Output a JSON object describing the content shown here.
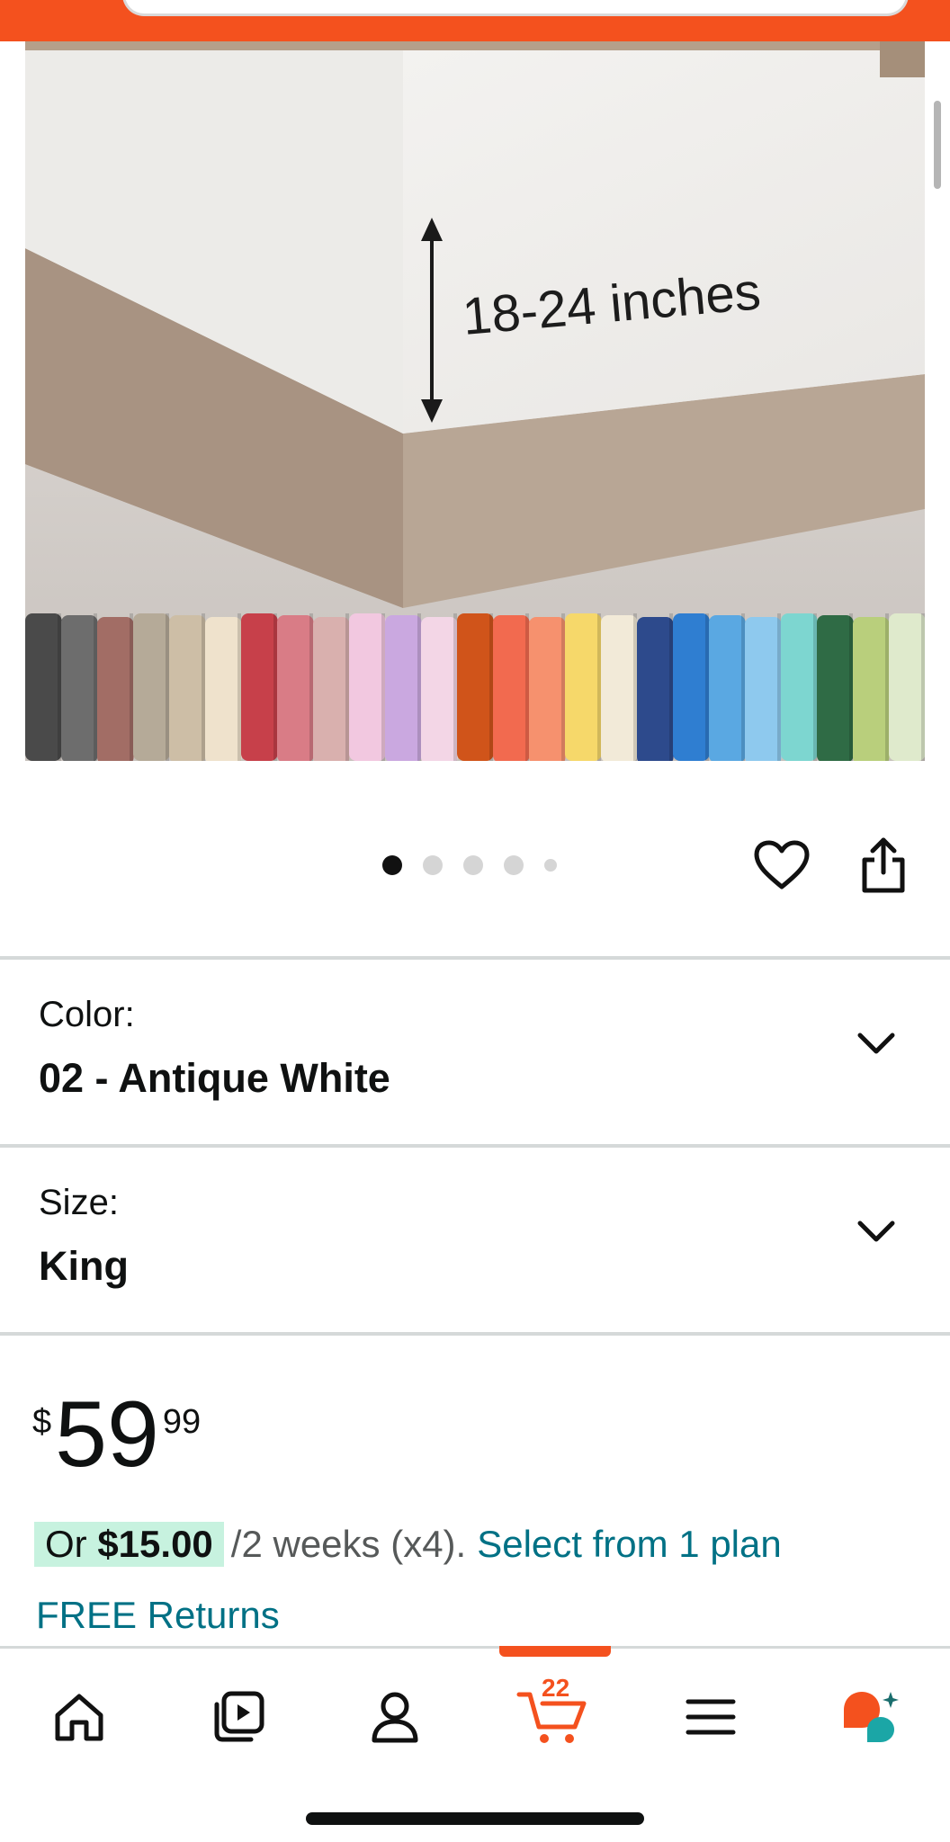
{
  "product_image": {
    "dimension_label": "18-24 inches",
    "swatch_colors": [
      "#4a4a4a",
      "#6d6d6d",
      "#a26d65",
      "#b5aa98",
      "#cdbea6",
      "#efe2cc",
      "#c7404a",
      "#d97c86",
      "#d9b0ae",
      "#f2c8e0",
      "#caa8e0",
      "#f3d6e6",
      "#d0541a",
      "#f26a4f",
      "#f6916e",
      "#f6d86a",
      "#f2ead8",
      "#2d4a8c",
      "#2f7ed1",
      "#5aa8e2",
      "#8ec9ee",
      "#7dd6d0",
      "#2f6b45",
      "#b9cf7c",
      "#dfeacc"
    ]
  },
  "carousel": {
    "page_count": 5,
    "active_index": 0
  },
  "actions": {
    "heart_icon": "heart-icon",
    "share_icon": "share-icon"
  },
  "color_selector": {
    "label": "Color:",
    "value": "02 - Antique White"
  },
  "size_selector": {
    "label": "Size:",
    "value": "King"
  },
  "price": {
    "symbol": "$",
    "whole": "59",
    "fraction": "99"
  },
  "installment": {
    "prefix": "Or ",
    "amount": "$15.00",
    "rest": "/2 weeks (x4).",
    "link": "Select from 1 plan"
  },
  "returns": {
    "label": "FREE Returns"
  },
  "bottom_nav": {
    "items": [
      "home-icon",
      "video-icon",
      "account-icon",
      "cart-icon",
      "menu-icon",
      "assistant-icon"
    ],
    "cart_count": "22"
  },
  "colors": {
    "accent": "#f4511e",
    "link": "#007185",
    "installment_badge": "#c7f2df"
  }
}
